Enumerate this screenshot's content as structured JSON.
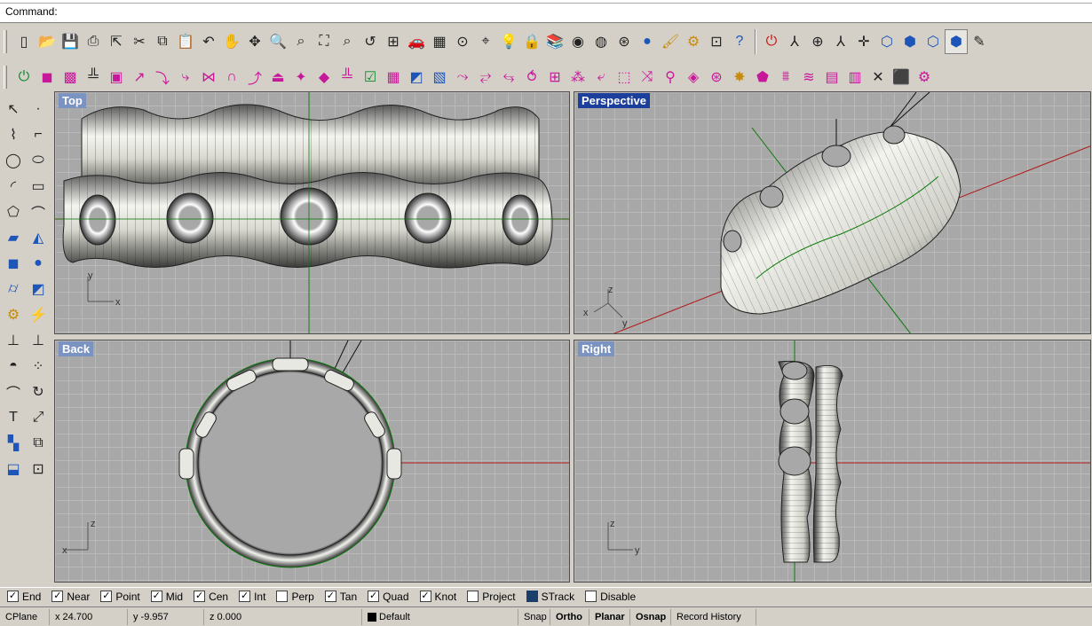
{
  "command": {
    "prompt": "Command:",
    "value": ""
  },
  "toolbar_main": [
    {
      "name": "new-file-icon",
      "glyph": "▯"
    },
    {
      "name": "open-folder-icon",
      "glyph": "📂"
    },
    {
      "name": "save-icon",
      "glyph": "💾"
    },
    {
      "name": "print-icon",
      "glyph": "⎙"
    },
    {
      "name": "export-icon",
      "glyph": "⇱"
    },
    {
      "name": "cut-icon",
      "glyph": "✂"
    },
    {
      "name": "copy-icon",
      "glyph": "⧉"
    },
    {
      "name": "paste-icon",
      "glyph": "📋"
    },
    {
      "name": "undo-icon",
      "glyph": "↶"
    },
    {
      "name": "pan-hand-icon",
      "glyph": "✋"
    },
    {
      "name": "rotate-view-icon",
      "glyph": "✥"
    },
    {
      "name": "zoom-icon",
      "glyph": "🔍"
    },
    {
      "name": "zoom-window-icon",
      "glyph": "⌕"
    },
    {
      "name": "zoom-extents-icon",
      "glyph": "⛶"
    },
    {
      "name": "zoom-selected-icon",
      "glyph": "⌕"
    },
    {
      "name": "undo-view-icon",
      "glyph": "↺"
    },
    {
      "name": "four-viewports-icon",
      "glyph": "⊞"
    },
    {
      "name": "car-render-icon",
      "glyph": "🚗"
    },
    {
      "name": "plane-grid-icon",
      "glyph": "▦"
    },
    {
      "name": "osnap-icon",
      "glyph": "⊙"
    },
    {
      "name": "select-point-icon",
      "glyph": "⌖"
    },
    {
      "name": "light-bulb-icon",
      "glyph": "💡"
    },
    {
      "name": "lock-icon",
      "glyph": "🔒"
    },
    {
      "name": "layers-icon",
      "glyph": "📚"
    },
    {
      "name": "color-wheel-icon",
      "glyph": "◉"
    },
    {
      "name": "wireframe-sphere-icon",
      "glyph": "◍"
    },
    {
      "name": "mesh-sphere-icon",
      "glyph": "⊛"
    },
    {
      "name": "render-sphere-icon",
      "glyph": "●"
    },
    {
      "name": "paint-brush-icon",
      "glyph": "🖌"
    },
    {
      "name": "options-gear-icon",
      "glyph": "⚙"
    },
    {
      "name": "properties-icon",
      "glyph": "⊡"
    },
    {
      "name": "help-icon",
      "glyph": "?"
    }
  ],
  "toolbar_right": [
    {
      "name": "cancel-icon",
      "glyph": "⏻"
    },
    {
      "name": "gumball-axis-icon",
      "glyph": "⅄"
    },
    {
      "name": "target-icon",
      "glyph": "⊕"
    },
    {
      "name": "axes-icon",
      "glyph": "⅄"
    },
    {
      "name": "xyz-axis-icon",
      "glyph": "✛"
    },
    {
      "name": "cube-view-icon",
      "glyph": "⬡"
    },
    {
      "name": "cube-front-icon",
      "glyph": "⬢"
    },
    {
      "name": "cube-side-icon",
      "glyph": "⬡"
    },
    {
      "name": "cube-top-icon",
      "glyph": "⬢"
    },
    {
      "name": "pen-icon",
      "glyph": "✎"
    }
  ],
  "toolbar_surface": [
    {
      "name": "power-icon",
      "glyph": "⏻"
    },
    {
      "name": "cube-pink-icon",
      "glyph": "◼"
    },
    {
      "name": "mesh-cube-icon",
      "glyph": "▩"
    },
    {
      "name": "ground-grid-icon",
      "glyph": "╩"
    },
    {
      "name": "box-edit-icon",
      "glyph": "▣"
    },
    {
      "name": "extend-arrow-icon",
      "glyph": "↗"
    },
    {
      "name": "fillet-icon",
      "glyph": "⤵"
    },
    {
      "name": "loft-icon",
      "glyph": "⤷"
    },
    {
      "name": "join-icon",
      "glyph": "⋈"
    },
    {
      "name": "arc-icon",
      "glyph": "∩"
    },
    {
      "name": "sweep-icon",
      "glyph": "⤴"
    },
    {
      "name": "extrude-icon",
      "glyph": "⏏"
    },
    {
      "name": "curve-net-icon",
      "glyph": "✦"
    },
    {
      "name": "patch-icon",
      "glyph": "◆"
    },
    {
      "name": "point-grid-icon",
      "glyph": "╩"
    },
    {
      "name": "check-grid-icon",
      "glyph": "☑"
    },
    {
      "name": "grid-pink-icon",
      "glyph": "▦"
    },
    {
      "name": "split-surface-icon",
      "glyph": "◩"
    },
    {
      "name": "trim-surface-icon",
      "glyph": "▧"
    },
    {
      "name": "flow-icon",
      "glyph": "⤳"
    },
    {
      "name": "blend-icon",
      "glyph": "⥂"
    },
    {
      "name": "offset-icon",
      "glyph": "⥃"
    },
    {
      "name": "bend-icon",
      "glyph": "⥀"
    },
    {
      "name": "cage-icon",
      "glyph": "⊞"
    },
    {
      "name": "dotted-grid-icon",
      "glyph": "⁂"
    },
    {
      "name": "corner-icon",
      "glyph": "⤶"
    },
    {
      "name": "dashed-box-icon",
      "glyph": "⬚"
    },
    {
      "name": "rebuild-icon",
      "glyph": "⤨"
    },
    {
      "name": "pin-icon",
      "glyph": "⚲"
    },
    {
      "name": "check-diamond-icon",
      "glyph": "◈"
    },
    {
      "name": "node-icon",
      "glyph": "⊛"
    },
    {
      "name": "star-icon",
      "glyph": "✸"
    },
    {
      "name": "pentagon-icon",
      "glyph": "⬟"
    },
    {
      "name": "bridge-icon",
      "glyph": "⩩"
    },
    {
      "name": "wave-icon",
      "glyph": "≋"
    },
    {
      "name": "soft-box-icon",
      "glyph": "▤"
    },
    {
      "name": "strip-icon",
      "glyph": "▥"
    },
    {
      "name": "cross-icon",
      "glyph": "✕"
    },
    {
      "name": "solid-box-icon",
      "glyph": "⬛"
    },
    {
      "name": "settings-gear-icon",
      "glyph": "⚙"
    }
  ],
  "sidebar": [
    {
      "name": "select-arrow-icon",
      "glyph": "↖"
    },
    {
      "name": "point-icon",
      "glyph": "·"
    },
    {
      "name": "polyline-icon",
      "glyph": "⌇"
    },
    {
      "name": "curve-icon",
      "glyph": "⌐"
    },
    {
      "name": "circle-icon",
      "glyph": "◯"
    },
    {
      "name": "ellipse-icon",
      "glyph": "⬭"
    },
    {
      "name": "arc-tool-icon",
      "glyph": "◜"
    },
    {
      "name": "rectangle-icon",
      "glyph": "▭"
    },
    {
      "name": "polygon-icon",
      "glyph": "⬠"
    },
    {
      "name": "fillet-curve-icon",
      "glyph": "⌒"
    },
    {
      "name": "surface-icon",
      "glyph": "▰"
    },
    {
      "name": "loft-surface-icon",
      "glyph": "◭"
    },
    {
      "name": "box-solid-icon",
      "glyph": "◼"
    },
    {
      "name": "sphere-union-icon",
      "glyph": "●"
    },
    {
      "name": "cylinder-icon",
      "glyph": "⌭"
    },
    {
      "name": "mesh-plane-icon",
      "glyph": "◩"
    },
    {
      "name": "gears-icon",
      "glyph": "⚙"
    },
    {
      "name": "flash-icon",
      "glyph": "⚡"
    },
    {
      "name": "move-icon",
      "glyph": "⊥"
    },
    {
      "name": "align-icon",
      "glyph": "⊥"
    },
    {
      "name": "boolean-icon",
      "glyph": "◓"
    },
    {
      "name": "array-icon",
      "glyph": "⁘"
    },
    {
      "name": "trim-icon",
      "glyph": "⌒"
    },
    {
      "name": "rotate-icon",
      "glyph": "↻"
    },
    {
      "name": "text-icon",
      "glyph": "T"
    },
    {
      "name": "scale-icon",
      "glyph": "⤢"
    },
    {
      "name": "group-icon",
      "glyph": "▚"
    },
    {
      "name": "mirror-icon",
      "glyph": "⧉"
    },
    {
      "name": "block-icon",
      "glyph": "⬓"
    },
    {
      "name": "dimension-icon",
      "glyph": "⊡"
    }
  ],
  "viewports": {
    "top": "Top",
    "perspective": "Perspective",
    "back": "Back",
    "right": "Right"
  },
  "axis_labels": {
    "x": "x",
    "y": "y",
    "z": "z"
  },
  "osnaps": [
    {
      "label": "End",
      "checked": true
    },
    {
      "label": "Near",
      "checked": true
    },
    {
      "label": "Point",
      "checked": true
    },
    {
      "label": "Mid",
      "checked": true
    },
    {
      "label": "Cen",
      "checked": true
    },
    {
      "label": "Int",
      "checked": true
    },
    {
      "label": "Perp",
      "checked": false
    },
    {
      "label": "Tan",
      "checked": true
    },
    {
      "label": "Quad",
      "checked": true
    },
    {
      "label": "Knot",
      "checked": true
    },
    {
      "label": "Project",
      "checked": false
    },
    {
      "label": "STrack",
      "checked": true,
      "filled": true
    },
    {
      "label": "Disable",
      "checked": false
    }
  ],
  "status": {
    "cplane": "CPlane",
    "x": "x 24.700",
    "y": "y -9.957",
    "z": "z 0.000",
    "layer": "Default",
    "snap": "Snap",
    "ortho": "Ortho",
    "planar": "Planar",
    "osnap": "Osnap",
    "record_history": "Record History"
  },
  "colors": {
    "viewport_bg": "#a8a8a8",
    "grid": "#b9b9b9",
    "x_axis": "#b01818",
    "y_axis": "#0a7a0a",
    "active_title": "#1b3f9a",
    "inactive_title": "#7a93c0"
  }
}
